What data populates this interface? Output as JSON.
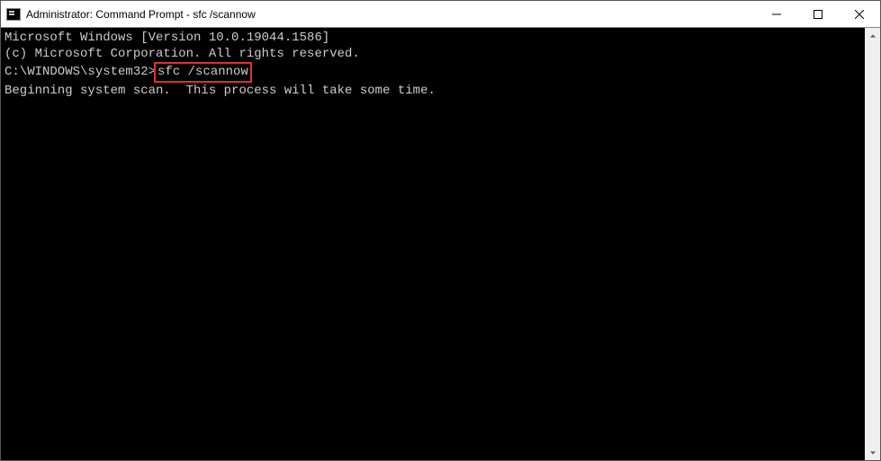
{
  "window": {
    "title": "Administrator: Command Prompt - sfc  /scannow"
  },
  "terminal": {
    "line1": "Microsoft Windows [Version 10.0.19044.1586]",
    "line2": "(c) Microsoft Corporation. All rights reserved.",
    "blank1": "",
    "prompt": "C:\\WINDOWS\\system32>",
    "command": "sfc /scannow",
    "blank2": "",
    "status": "Beginning system scan.  This process will take some time."
  },
  "highlight": {
    "color": "#e03030"
  }
}
